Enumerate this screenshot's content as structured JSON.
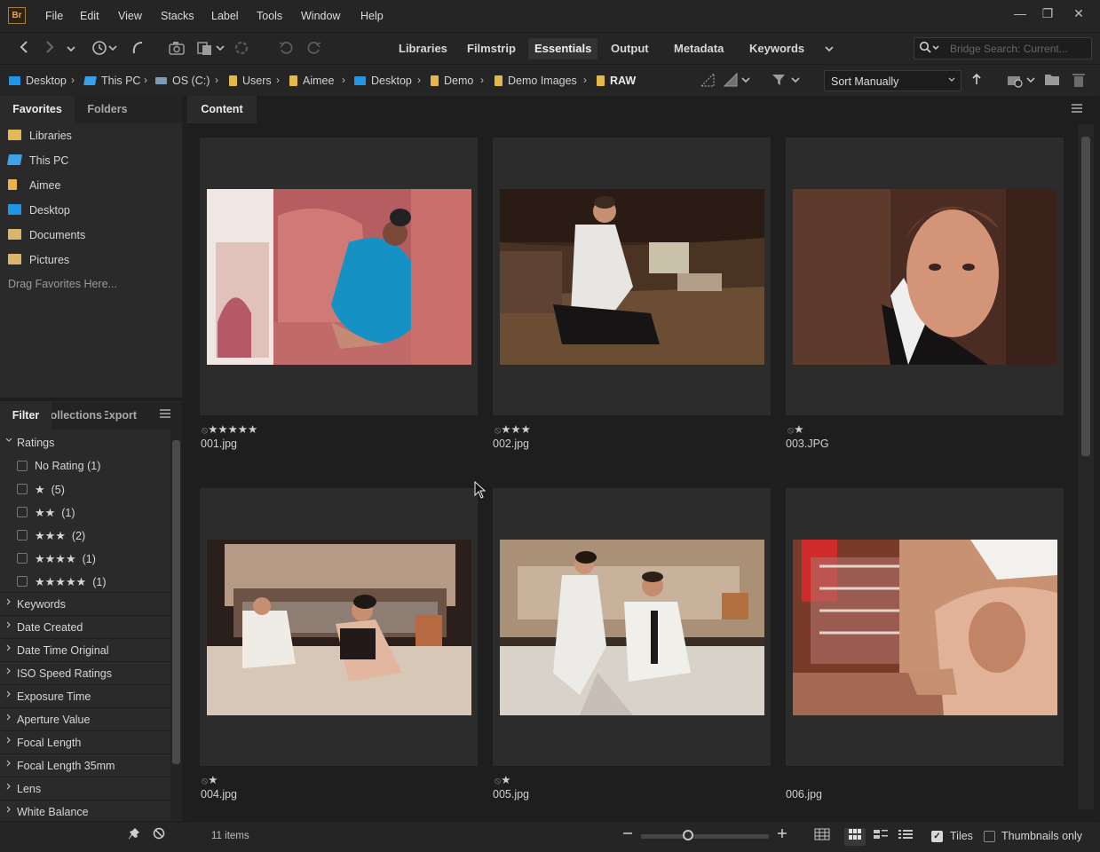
{
  "app": {
    "logo": "Br"
  },
  "menu": [
    "File",
    "Edit",
    "View",
    "Stacks",
    "Label",
    "Tools",
    "Window",
    "Help"
  ],
  "window_controls": {
    "minimize": "—",
    "maximize": "❐",
    "close": "✕"
  },
  "workspaces": {
    "items": [
      "Libraries",
      "Filmstrip",
      "Essentials",
      "Output",
      "Metadata",
      "Keywords"
    ],
    "active": "Essentials"
  },
  "search": {
    "placeholder": "Bridge Search: Current..."
  },
  "breadcrumb": {
    "items": [
      "Desktop",
      "This PC",
      "OS (C:)",
      "Users",
      "Aimee",
      "Desktop",
      "Demo",
      "Demo Images",
      "RAW"
    ],
    "separator": "›"
  },
  "sort": {
    "value": "Sort Manually"
  },
  "favorites_panel": {
    "tabs": [
      "Favorites",
      "Folders"
    ],
    "items": [
      "Libraries",
      "This PC",
      "Aimee",
      "Desktop",
      "Documents",
      "Pictures"
    ],
    "drag_hint": "Drag Favorites Here..."
  },
  "filter_panel": {
    "tabs": [
      "Filter",
      "Collections",
      "Export"
    ],
    "ratings_header": "Ratings",
    "ratings": [
      {
        "label": "No Rating",
        "stars": "",
        "count": "(1)"
      },
      {
        "label": "",
        "stars": "★",
        "count": "(5)"
      },
      {
        "label": "",
        "stars": "★★",
        "count": "(1)"
      },
      {
        "label": "",
        "stars": "★★★",
        "count": "(2)"
      },
      {
        "label": "",
        "stars": "★★★★",
        "count": "(1)"
      },
      {
        "label": "",
        "stars": "★★★★★",
        "count": "(1)"
      }
    ],
    "sections": [
      "Keywords",
      "Date Created",
      "Date Time Original",
      "ISO Speed Ratings",
      "Exposure Time",
      "Aperture Value",
      "Focal Length",
      "Focal Length 35mm",
      "Lens",
      "White Balance"
    ]
  },
  "content": {
    "tab": "Content",
    "tiles": [
      {
        "filename": "001.jpg",
        "rating": "★★★★★",
        "reject": "⦸"
      },
      {
        "filename": "002.jpg",
        "rating": "★★★",
        "reject": "⦸"
      },
      {
        "filename": "003.JPG",
        "rating": "★",
        "reject": "⦸"
      },
      {
        "filename": "004.jpg",
        "rating": "★",
        "reject": "⦸"
      },
      {
        "filename": "005.jpg",
        "rating": "★",
        "reject": "⦸"
      },
      {
        "filename": "006.jpg",
        "rating": "",
        "reject": ""
      }
    ]
  },
  "statusbar": {
    "items_count": "11 items",
    "tiles_label": "Tiles",
    "tiles_checked": true,
    "thumbnails_only_label": "Thumbnails only",
    "thumbnails_only_checked": false
  },
  "colors": {
    "accent_star": "#d6d6d6",
    "folder_yellow": "#e6b84a",
    "folder_blue": "#2196e6"
  }
}
